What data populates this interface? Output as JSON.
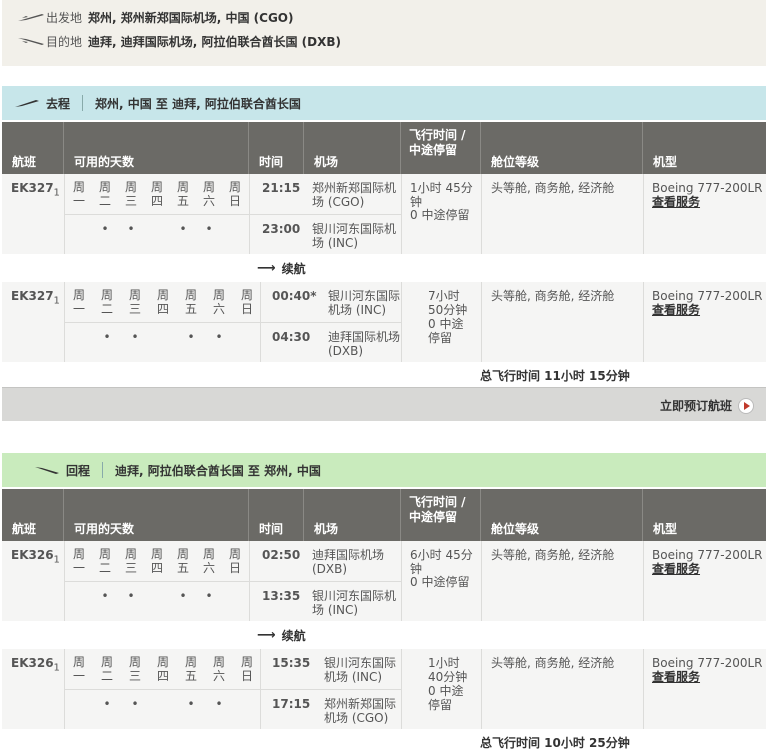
{
  "summary": {
    "origin_label": "出发地",
    "origin_value": "郑州, 郑州新郑国际机场, 中国 (CGO)",
    "dest_label": "目的地",
    "dest_value": "迪拜, 迪拜国际机场, 阿拉伯联合酋长国 (DXB)"
  },
  "outbound": {
    "direction": "去程",
    "route": "郑州, 中国 至 迪拜, 阿拉伯联合酋长国",
    "total": "总飞行时间 11小时 15分钟",
    "continue_label": "续航",
    "legs": [
      {
        "flight": "EK327",
        "sub": "1",
        "dep_time": "21:15",
        "dep_airport": "郑州新郑国际机场 (CGO)",
        "arr_time": "23:00",
        "arr_airport": "银川河东国际机场 (INC)",
        "duration": "1小时 45分钟",
        "stops": "0 中途停留",
        "cabin": "头等舱, 商务舱, 经济舱",
        "aircraft": "Boeing 777-200LR",
        "service": "查看服务"
      },
      {
        "flight": "EK327",
        "sub": "1",
        "dep_time": "00:40*",
        "dep_airport": "银川河东国际机场 (INC)",
        "arr_time": "04:30",
        "arr_airport": "迪拜国际机场 (DXB)",
        "duration": "7小时 50分钟",
        "stops": "0 中途停留",
        "cabin": "头等舱, 商务舱, 经济舱",
        "aircraft": "Boeing 777-200LR",
        "service": "查看服务"
      }
    ]
  },
  "return": {
    "direction": "回程",
    "route": "迪拜, 阿拉伯联合酋长国 至 郑州, 中国",
    "total": "总飞行时间 10小时 25分钟",
    "continue_label": "续航",
    "legs": [
      {
        "flight": "EK326",
        "sub": "1",
        "dep_time": "02:50",
        "dep_airport": "迪拜国际机场 (DXB)",
        "arr_time": "13:35",
        "arr_airport": "银川河东国际机场 (INC)",
        "duration": "6小时 45分钟",
        "stops": "0 中途停留",
        "cabin": "头等舱, 商务舱, 经济舱",
        "aircraft": "Boeing 777-200LR",
        "service": "查看服务"
      },
      {
        "flight": "EK326",
        "sub": "1",
        "dep_time": "15:35",
        "dep_airport": "银川河东国际机场 (INC)",
        "arr_time": "17:15",
        "arr_airport": "郑州新郑国际机场 (CGO)",
        "duration": "1小时 40分钟",
        "stops": "0 中途停留",
        "cabin": "头等舱, 商务舱, 经济舱",
        "aircraft": "Boeing 777-200LR",
        "service": "查看服务"
      }
    ]
  },
  "columns": {
    "flight": "航班",
    "days": "可用的天数",
    "time": "时间",
    "airport": "机场",
    "duration": "飞行时间 / 中途停留",
    "cabin": "舱位等级",
    "aircraft": "机型"
  },
  "days": [
    "周一",
    "周二",
    "周三",
    "周四",
    "周五",
    "周六",
    "周日"
  ],
  "dot": "•",
  "book_label": "立即预订航班",
  "colors": {
    "outbound_bg": "#c7e6ea",
    "return_bg": "#c9ebbd",
    "header_bg": "#6b6a66"
  }
}
